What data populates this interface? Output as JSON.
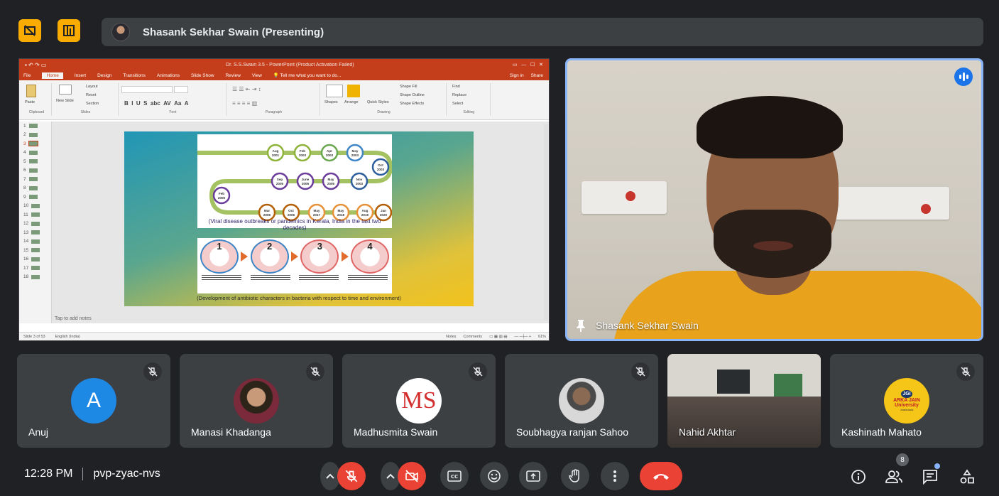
{
  "meeting": {
    "presenter_banner": "Shasank Sekhar Swain (Presenting)",
    "time": "12:28 PM",
    "code": "pvp-zyac-nvs",
    "participant_count": "8"
  },
  "top_buttons": [
    {
      "icon": "hide-layout-icon"
    },
    {
      "icon": "layout-icon"
    }
  ],
  "powerpoint": {
    "window_title": "Dr. S.S.Swain 3.5 - PowerPoint (Product Activation Failed)",
    "tabs": [
      "File",
      "Home",
      "Insert",
      "Design",
      "Transitions",
      "Animations",
      "Slide Show",
      "Review",
      "View"
    ],
    "tell_me": "Tell me what you want to do...",
    "sign_in": "Sign in",
    "share": "Share",
    "ribbon_groups": [
      "Clipboard",
      "Slides",
      "Font",
      "Paragraph",
      "Drawing",
      "Editing"
    ],
    "ribbon_items": {
      "paste": "Paste",
      "new_slide": "New Slide",
      "layout": "Layout",
      "reset": "Reset",
      "section": "Section",
      "shapes": "Shapes",
      "arrange": "Arrange",
      "quick_styles": "Quick Styles",
      "shape_fill": "Shape Fill",
      "shape_outline": "Shape Outline",
      "shape_effects": "Shape Effects",
      "find": "Find",
      "replace": "Replace",
      "select": "Select"
    },
    "slide_numbers": [
      "1",
      "2",
      "3",
      "4",
      "5",
      "6",
      "7",
      "8",
      "9",
      "10",
      "11",
      "12",
      "13",
      "14",
      "15",
      "16",
      "17",
      "18"
    ],
    "selected_slide": 3,
    "caption1": "(Viral disease outbreaks or pandemics in Kerala, India in the last two decades)",
    "caption2": "(Development of antibiotic characters in bacteria with respect to time and environment)",
    "timeline_nodes": [
      "Aug 2001",
      "Feb 2003",
      "Apr 2003",
      "May 2003",
      "Oct 2003",
      "Sep 2005",
      "June 2005",
      "May 2005",
      "Nov 2003",
      "Feb 2006",
      "Mar 2006",
      "Oct 2006",
      "May 2017",
      "May 2018",
      "Aug 2019",
      "Jan 2020"
    ],
    "resistance_steps": [
      "1",
      "2",
      "3",
      "4"
    ],
    "notes_placeholder": "Tap to add notes",
    "status_slide": "Slide 3 of 53",
    "status_lang": "English (India)",
    "status_notes": "Notes",
    "status_comments": "Comments",
    "zoom": "61%"
  },
  "speaker": {
    "name": "Shasank Sekhar Swain"
  },
  "participants": [
    {
      "name": "Anuj",
      "initial": "A",
      "avatar_color": "#1e88e5"
    },
    {
      "name": "Manasi Khadanga"
    },
    {
      "name": "Madhusmita Swain",
      "initials": "MS"
    },
    {
      "name": "Soubhagya ranjan Sahoo"
    },
    {
      "name": "Nahid Akhtar"
    },
    {
      "name": "Kashinath Mahato",
      "logo_top": "JGI",
      "logo_line1": "ARKA JAIN",
      "logo_line2": "University",
      "logo_line3": "Jharkhand"
    }
  ],
  "colors": {
    "background": "#202124",
    "tile": "#3c4043",
    "accent_red": "#ea4335",
    "accent_yellow": "#f9ab00",
    "speaking_blue": "#1a73e8"
  }
}
